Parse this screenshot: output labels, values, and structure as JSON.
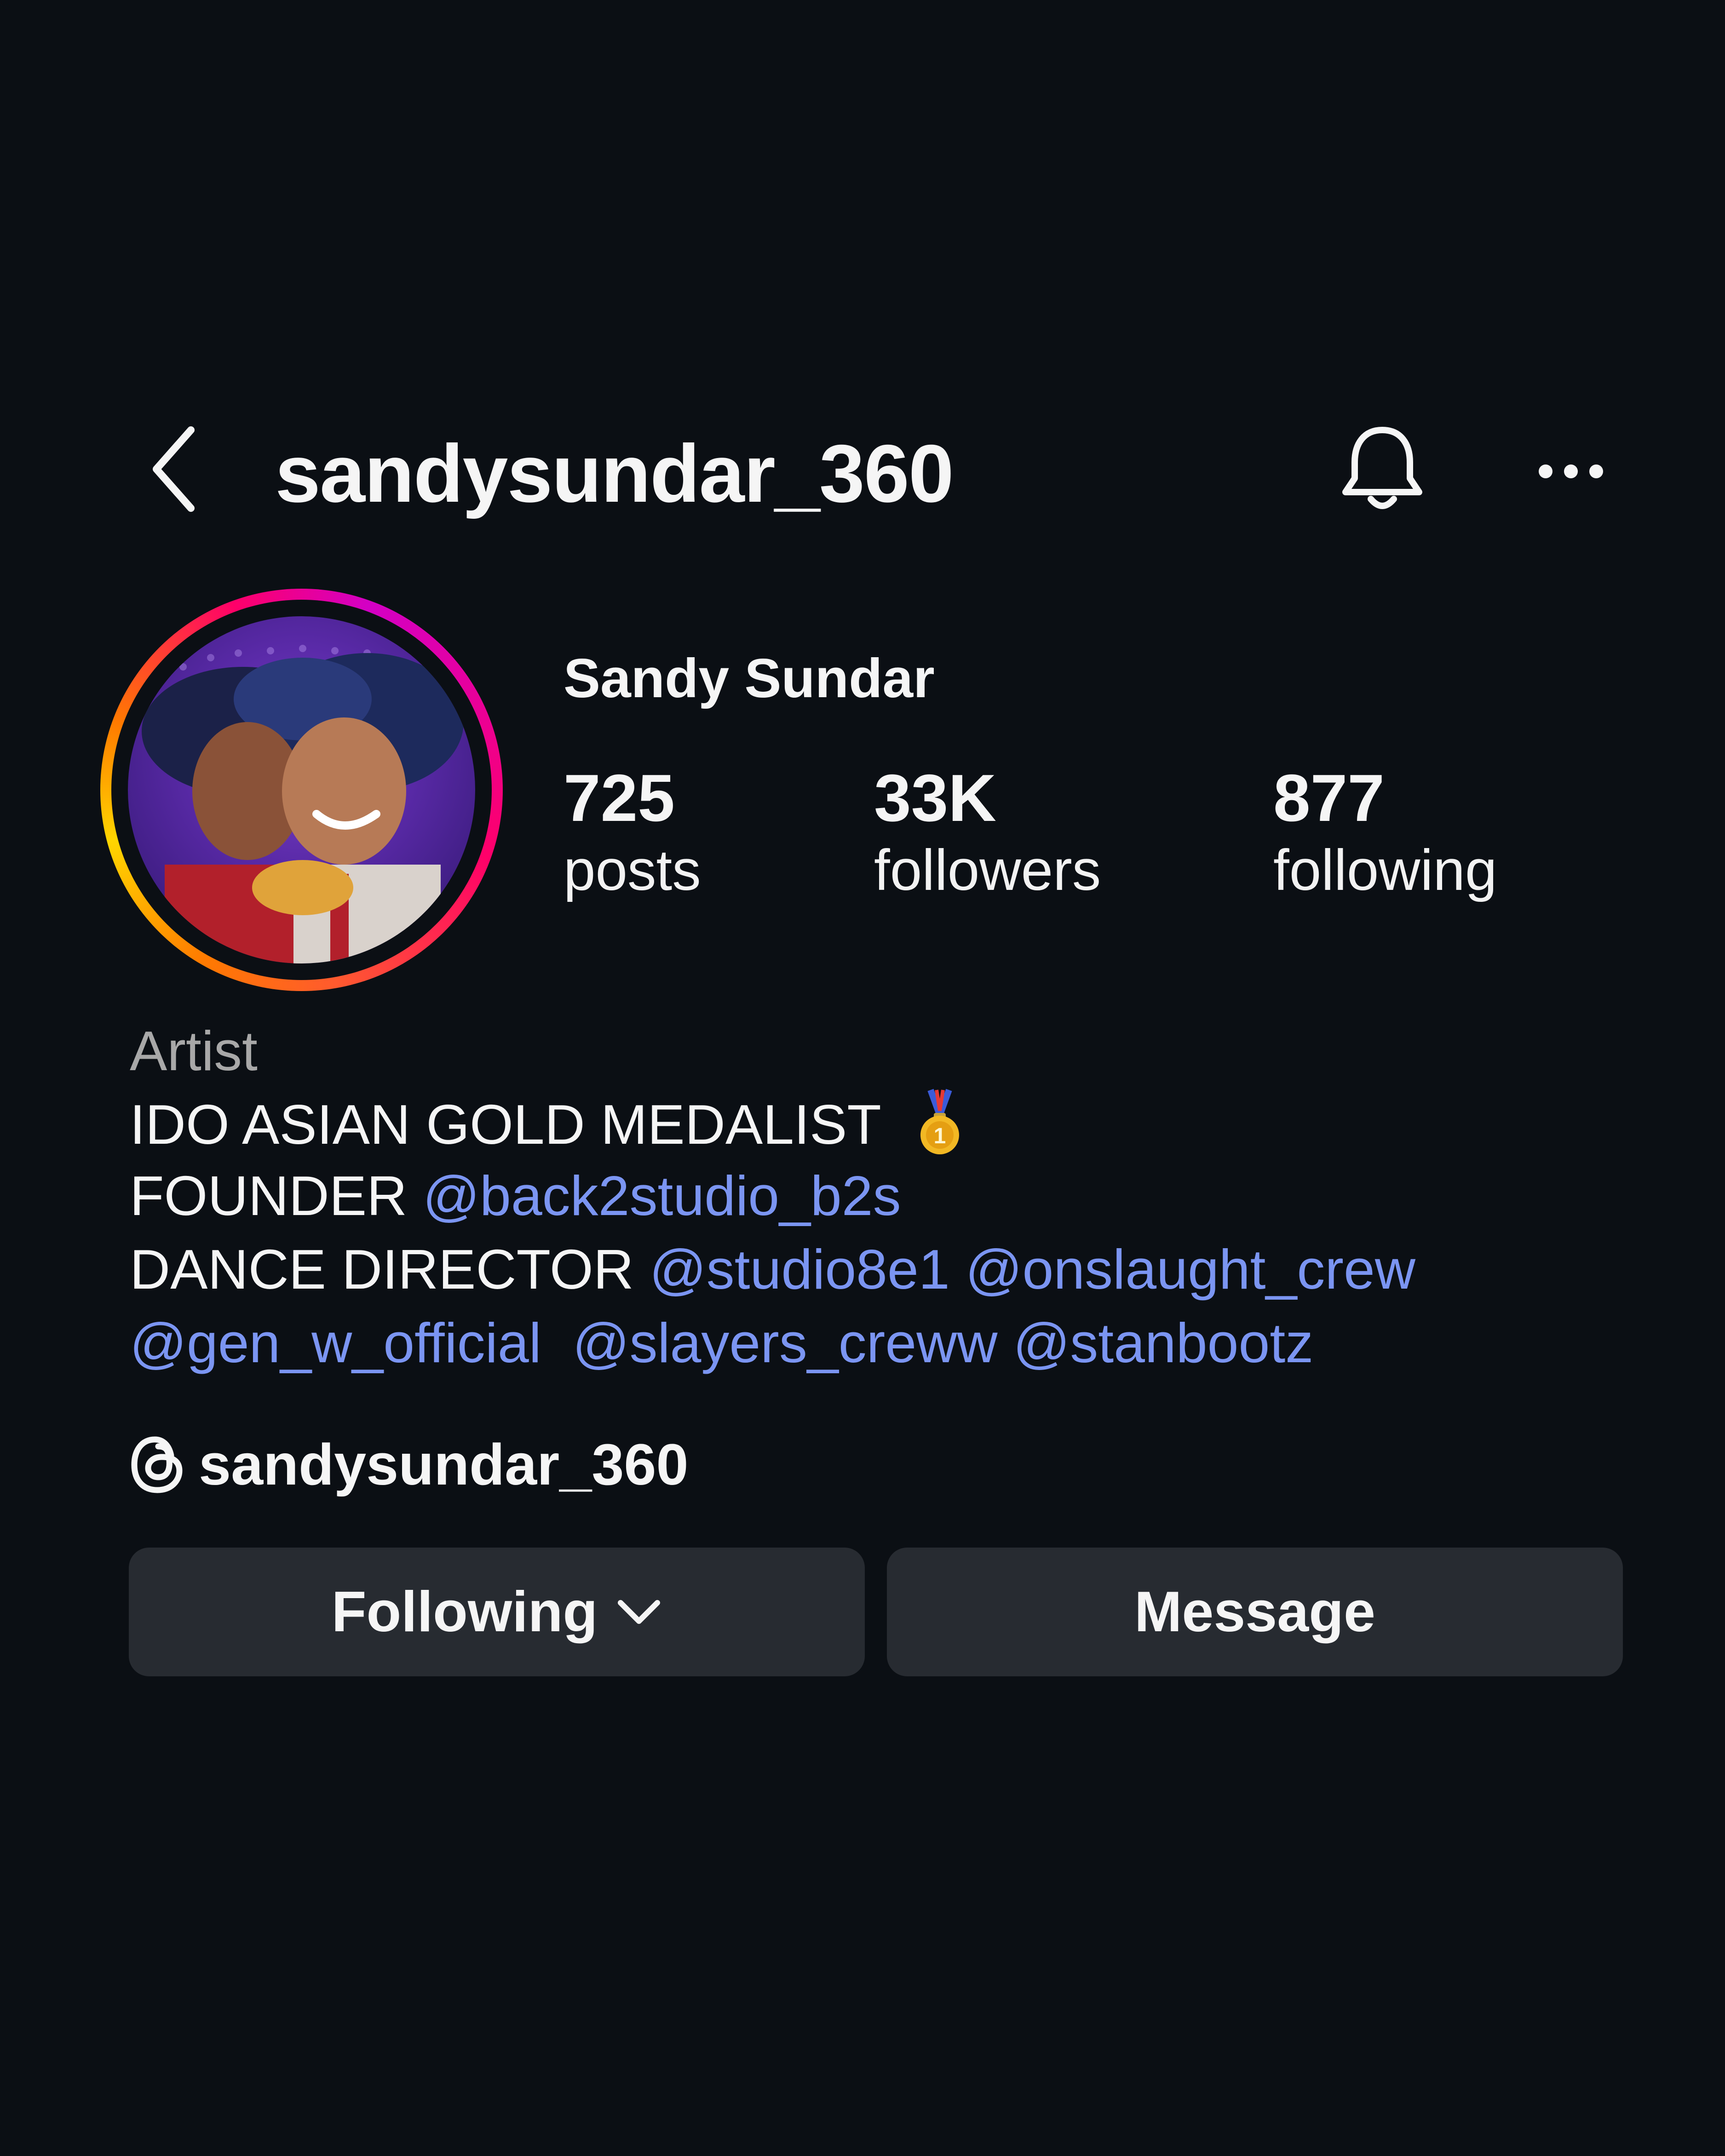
{
  "header": {
    "username": "sandysundar_360",
    "back_icon": "chevron-left-icon",
    "bell_icon": "bell-icon",
    "more_icon": "more-horizontal-icon"
  },
  "profile": {
    "full_name": "Sandy Sundar",
    "stats": [
      {
        "value": "725",
        "label": "posts"
      },
      {
        "value": "33K",
        "label": "followers"
      },
      {
        "value": "877",
        "label": "following"
      }
    ]
  },
  "bio": {
    "category": "Artist",
    "line1": "IDO ASIAN GOLD MEDALIST",
    "line1_emoji": "gold-medal-icon",
    "line2_prefix": "FOUNDER",
    "line2_mention": "@back2studio_b2s",
    "line3_prefix": "DANCE DIRECTOR",
    "line3_mentions": [
      "@studio8e1",
      "@onslaught_crew"
    ],
    "line4_mentions": [
      "@gen_w_official",
      "@slayers_creww",
      "@stanbootz"
    ]
  },
  "threads": {
    "icon": "threads-icon",
    "handle": "sandysundar_360"
  },
  "actions": {
    "following_label": "Following",
    "message_label": "Message"
  },
  "colors": {
    "background": "#0b0f14",
    "mention": "#7b95f2",
    "button_bg": "#272b31",
    "category_text": "#a8a8a8"
  }
}
